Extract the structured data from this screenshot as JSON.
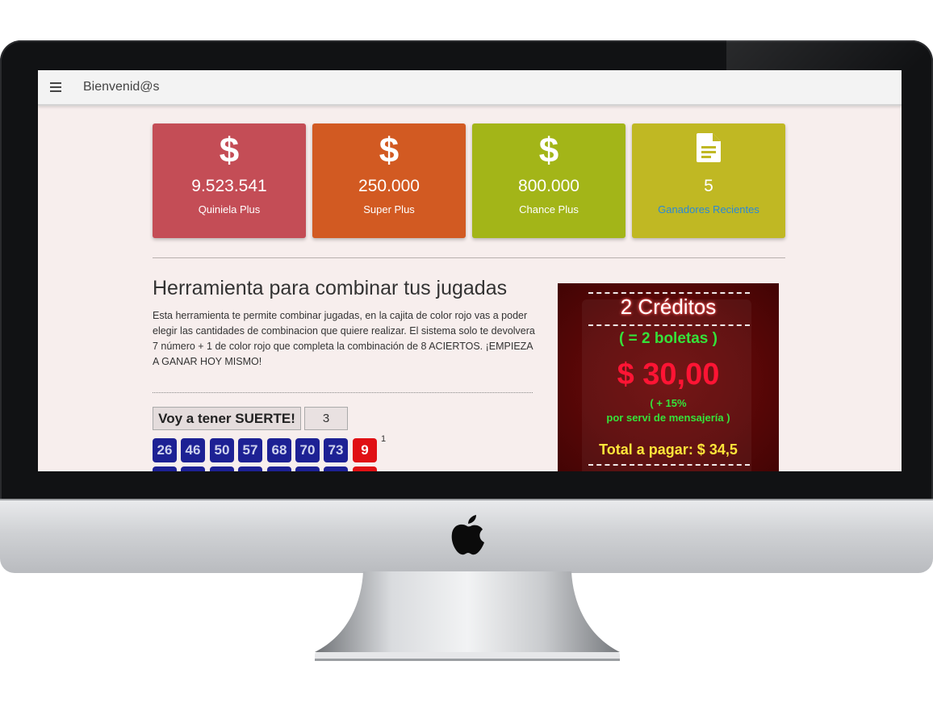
{
  "topbar": {
    "title": "Bienvenid@s"
  },
  "cards": [
    {
      "icon": "dollar-icon",
      "value": "9.523.541",
      "label": "Quiniela Plus",
      "color": "#c44d56"
    },
    {
      "icon": "dollar-icon",
      "value": "250.000",
      "label": "Super Plus",
      "color": "#d25a22"
    },
    {
      "icon": "dollar-icon",
      "value": "800.000",
      "label": "Chance Plus",
      "color": "#a3b518"
    },
    {
      "icon": "document-icon",
      "value": "5",
      "label": "Ganadores Recientes",
      "color": "#c0b823"
    }
  ],
  "tool": {
    "title": "Herramienta para combinar tus jugadas",
    "description": "Esta herramienta te permite combinar jugadas, en la cajita de color rojo vas a poder elegir las cantidades de combinacion que quiere realizar. El sistema solo te devolvera 7 número + 1 de color rojo que completa la combinación de 8 ACIERTOS. ¡EMPIEZA A GANAR HOY MISMO!",
    "luck_button": "Voy a tener SUERTE!",
    "quantity_value": "3",
    "rows": [
      {
        "index": "1",
        "numbers": [
          "26",
          "46",
          "50",
          "57",
          "68",
          "70",
          "73"
        ],
        "red": "9"
      }
    ]
  },
  "promo": {
    "credits": "2 Créditos",
    "boletas": "( = 2 boletas )",
    "price": "$ 30,00",
    "surcharge": "( + 15%",
    "surcharge_note": "por servi de mensajería )",
    "total": "Total a pagar: $ 34,5"
  }
}
